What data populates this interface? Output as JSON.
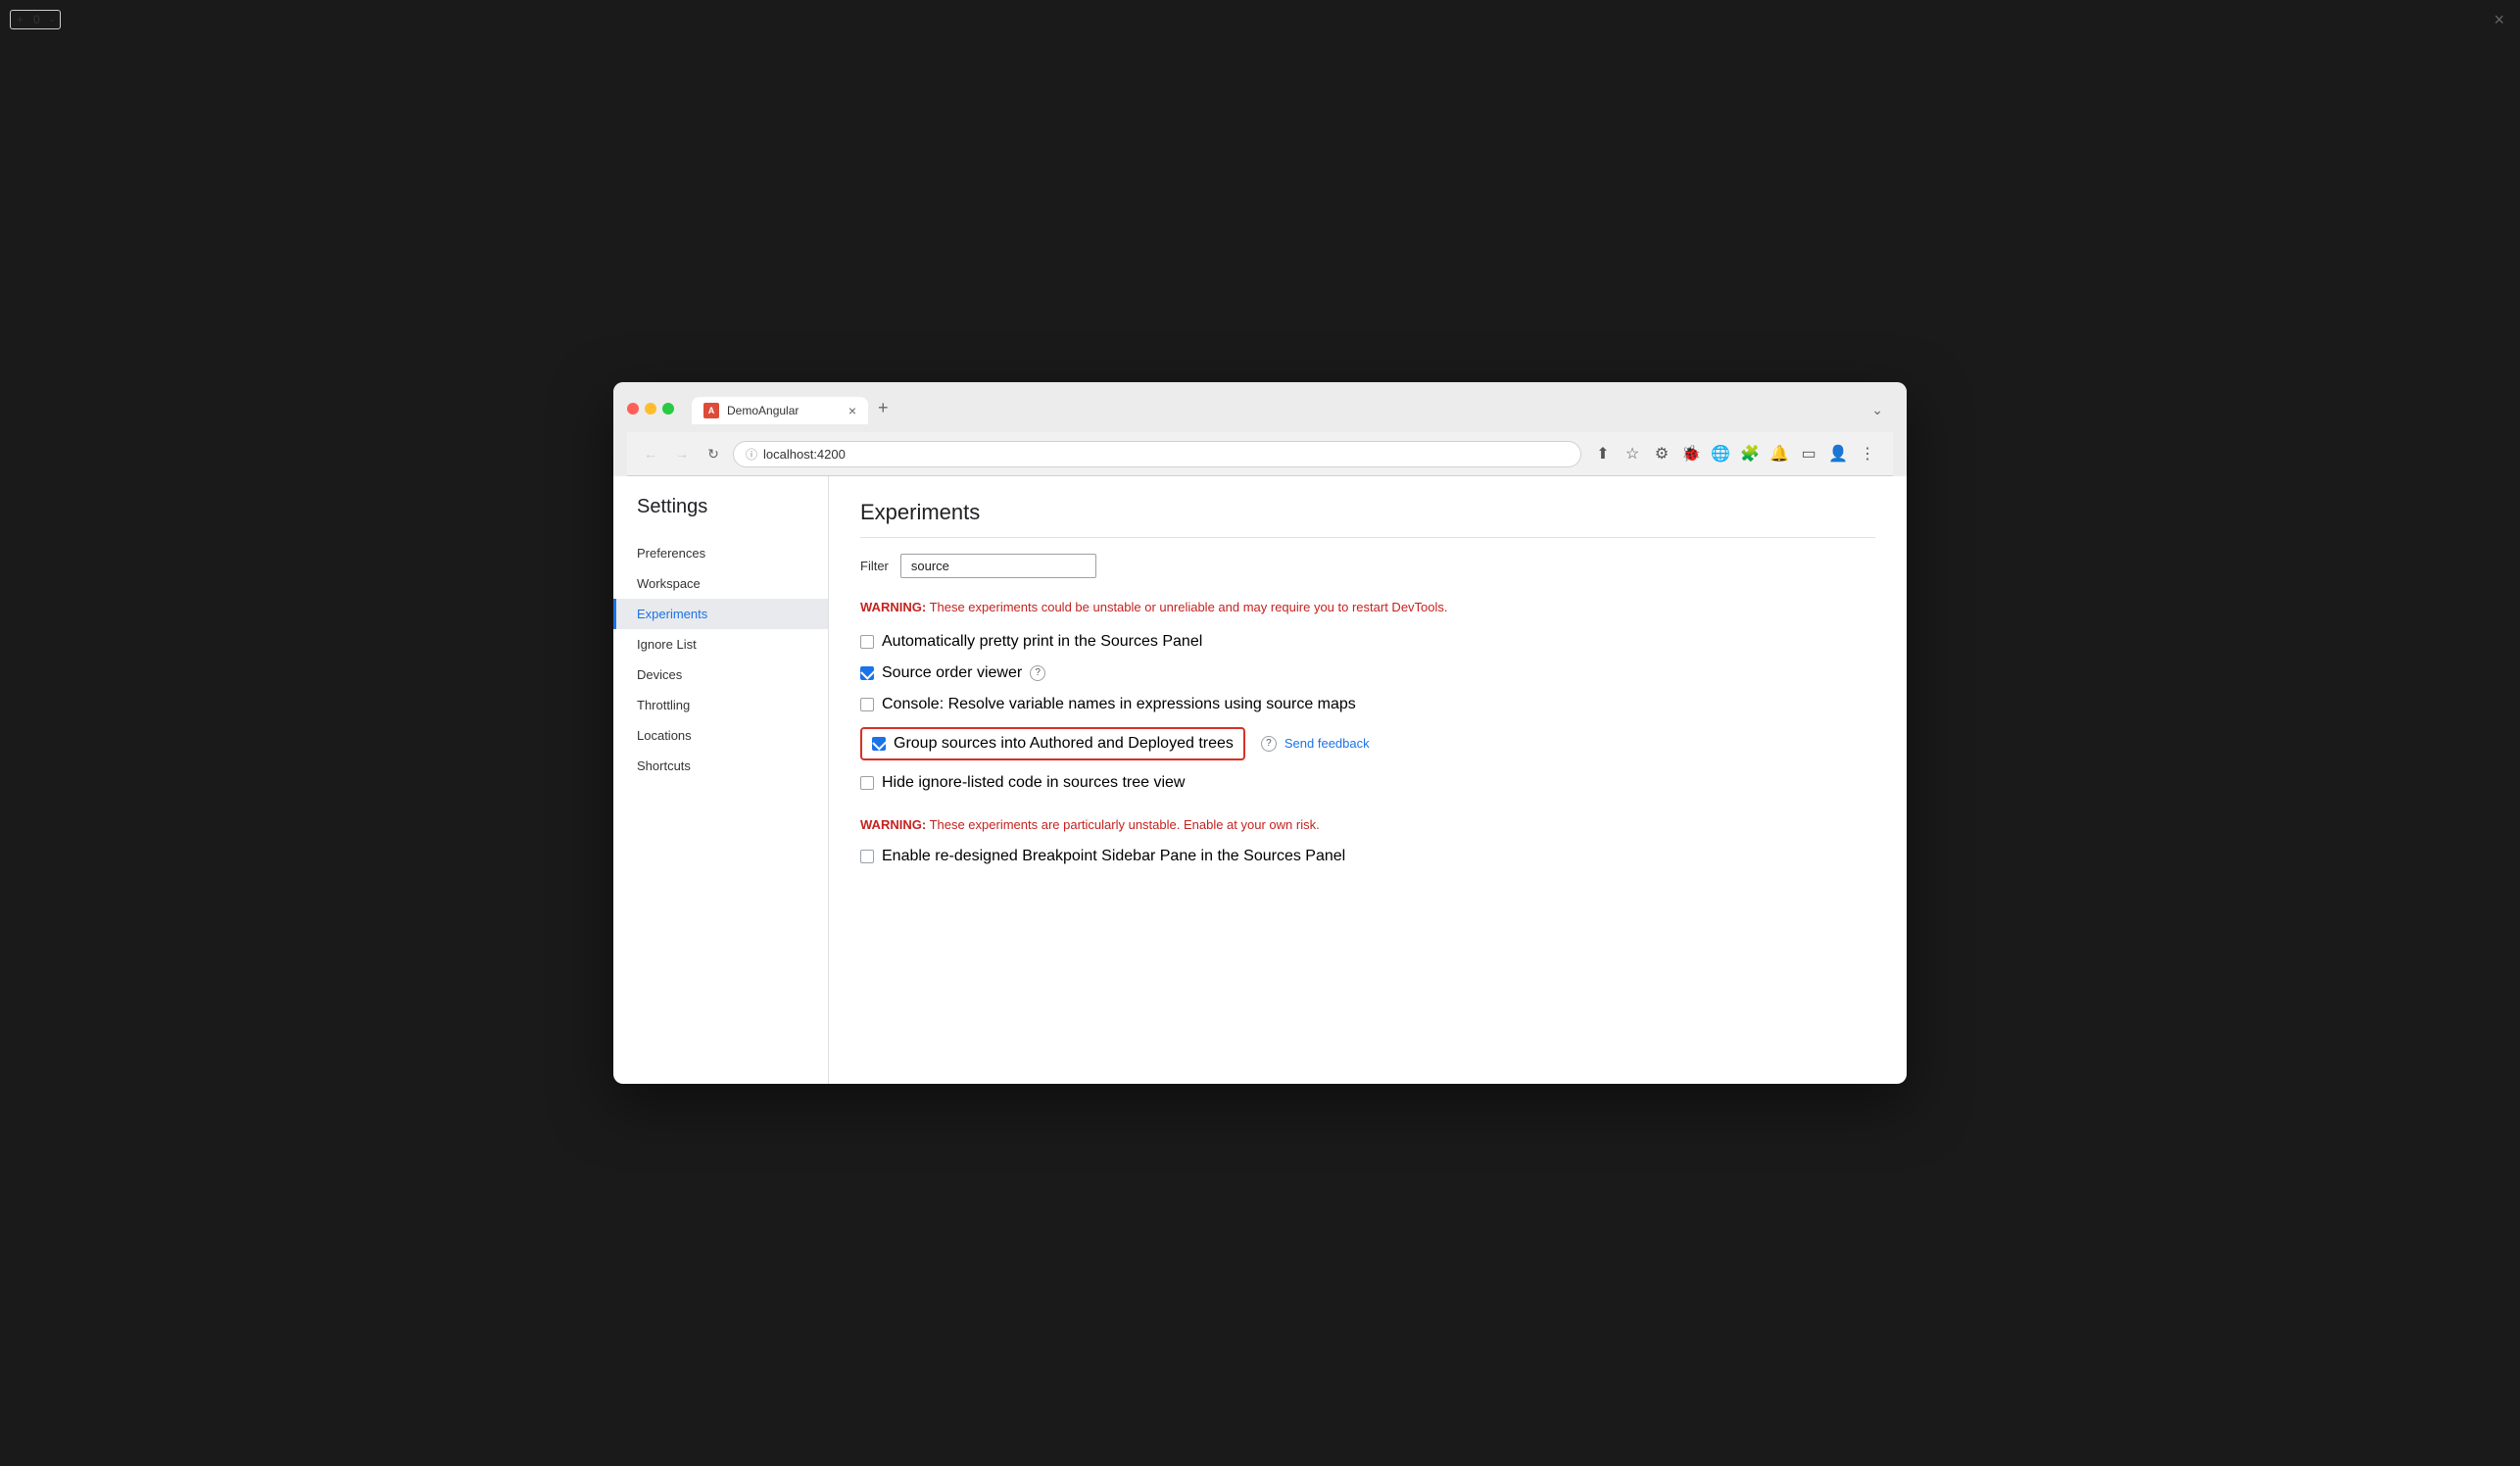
{
  "browser": {
    "traffic_lights": [
      "red",
      "yellow",
      "green"
    ],
    "tab": {
      "favicon_text": "A",
      "title": "DemoAngular",
      "close_label": "×"
    },
    "new_tab_label": "+",
    "expand_label": "⌄",
    "nav": {
      "back_label": "←",
      "forward_label": "→",
      "reload_label": "↻",
      "url": "localhost:4200"
    },
    "toolbar_icons": [
      "⬆",
      "☆",
      "⚙",
      "🐞",
      "🌐",
      "🧩",
      "🔔",
      "▭",
      "👤",
      "⋮"
    ]
  },
  "devtools": {
    "counter": {
      "plus_label": "+",
      "value": "0",
      "minus_label": "-"
    },
    "close_label": "×",
    "settings": {
      "title": "Settings",
      "nav_items": [
        {
          "id": "preferences",
          "label": "Preferences",
          "active": false
        },
        {
          "id": "workspace",
          "label": "Workspace",
          "active": false
        },
        {
          "id": "experiments",
          "label": "Experiments",
          "active": true
        },
        {
          "id": "ignore-list",
          "label": "Ignore List",
          "active": false
        },
        {
          "id": "devices",
          "label": "Devices",
          "active": false
        },
        {
          "id": "throttling",
          "label": "Throttling",
          "active": false
        },
        {
          "id": "locations",
          "label": "Locations",
          "active": false
        },
        {
          "id": "shortcuts",
          "label": "Shortcuts",
          "active": false
        }
      ]
    },
    "experiments": {
      "page_title": "Experiments",
      "filter_label": "Filter",
      "filter_value": "source",
      "filter_placeholder": "Filter",
      "warning1": "WARNING: These experiments could be unstable or unreliable and may require you to restart DevTools.",
      "warning1_label": "WARNING:",
      "warning1_text": " These experiments could be unstable or unreliable and may require you to restart DevTools.",
      "experiments": [
        {
          "id": "auto-pretty-print",
          "label": "Automatically pretty print in the Sources Panel",
          "checked": false,
          "highlighted": false,
          "has_help": false,
          "has_feedback": false
        },
        {
          "id": "source-order-viewer",
          "label": "Source order viewer",
          "checked": true,
          "highlighted": false,
          "has_help": true,
          "has_feedback": false
        },
        {
          "id": "console-resolve-variable",
          "label": "Console: Resolve variable names in expressions using source maps",
          "checked": false,
          "highlighted": false,
          "has_help": false,
          "has_feedback": false
        },
        {
          "id": "group-sources",
          "label": "Group sources into Authored and Deployed trees",
          "checked": true,
          "highlighted": true,
          "has_help": true,
          "has_feedback": true,
          "feedback_label": "Send feedback"
        },
        {
          "id": "hide-ignore-listed",
          "label": "Hide ignore-listed code in sources tree view",
          "checked": false,
          "highlighted": false,
          "has_help": false,
          "has_feedback": false
        }
      ],
      "warning2": "WARNING: These experiments are particularly unstable. Enable at your own risk.",
      "warning2_label": "WARNING:",
      "warning2_text": " These experiments are particularly unstable. Enable at your own risk.",
      "experiments2": [
        {
          "id": "redesigned-breakpoint",
          "label": "Enable re-designed Breakpoint Sidebar Pane in the Sources Panel",
          "checked": false,
          "highlighted": false,
          "has_help": false,
          "has_feedback": false
        }
      ]
    }
  }
}
